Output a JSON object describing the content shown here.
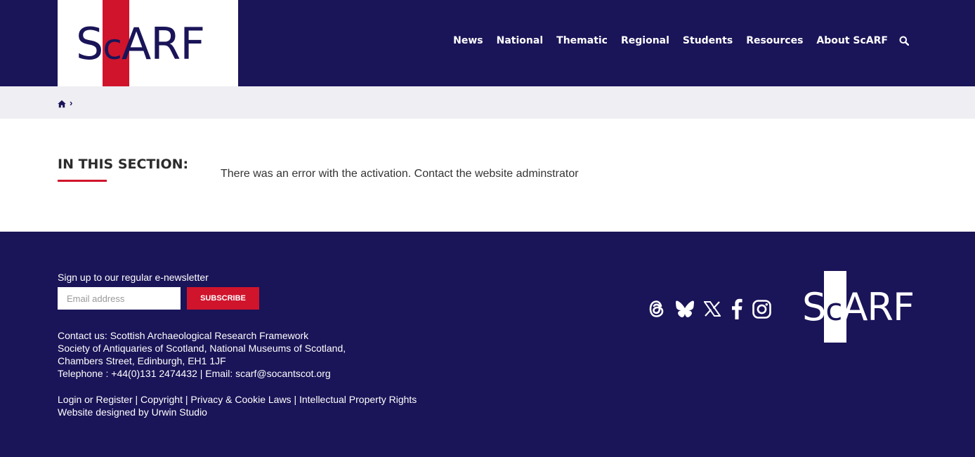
{
  "brand": {
    "logo_s": "S",
    "logo_c": "c",
    "logo_rest": "ARF",
    "colors": {
      "navy": "#1a1458",
      "red": "#d0142c",
      "breadcrumb_bg": "#eeeef3"
    }
  },
  "nav": {
    "items": [
      {
        "label": "News"
      },
      {
        "label": "National"
      },
      {
        "label": "Thematic"
      },
      {
        "label": "Regional"
      },
      {
        "label": "Students"
      },
      {
        "label": "Resources"
      },
      {
        "label": "About ScARF"
      }
    ],
    "search_icon": "search-icon"
  },
  "breadcrumb": {
    "home_icon": "home-icon",
    "separator": "›"
  },
  "main": {
    "section_title": "IN THIS SECTION:",
    "message": "There was an error with the activation. Contact the website adminstrator"
  },
  "footer": {
    "newsletter_label": "Sign up to our regular e-newsletter",
    "email_placeholder": "Email address",
    "subscribe_label": "SUBSCRIBE",
    "contact": {
      "line1": "Contact us: Scottish Archaeological Research Framework",
      "line2": "Society of Antiquaries of Scotland, National Museums of Scotland,",
      "line3": "Chambers Street, Edinburgh, EH1 1JF",
      "line4": "Telephone : +44(0)131 2474432 | Email: scarf@socantscot.org"
    },
    "links": {
      "login": "Login or Register",
      "copyright": "Copyright",
      "privacy": "Privacy & Cookie Laws",
      "ip": "Intellectual Property Rights",
      "divider": "|"
    },
    "designed_by": "Website designed by Urwin Studio",
    "social": [
      "threads-icon",
      "bluesky-icon",
      "x-icon",
      "facebook-icon",
      "instagram-icon"
    ]
  }
}
